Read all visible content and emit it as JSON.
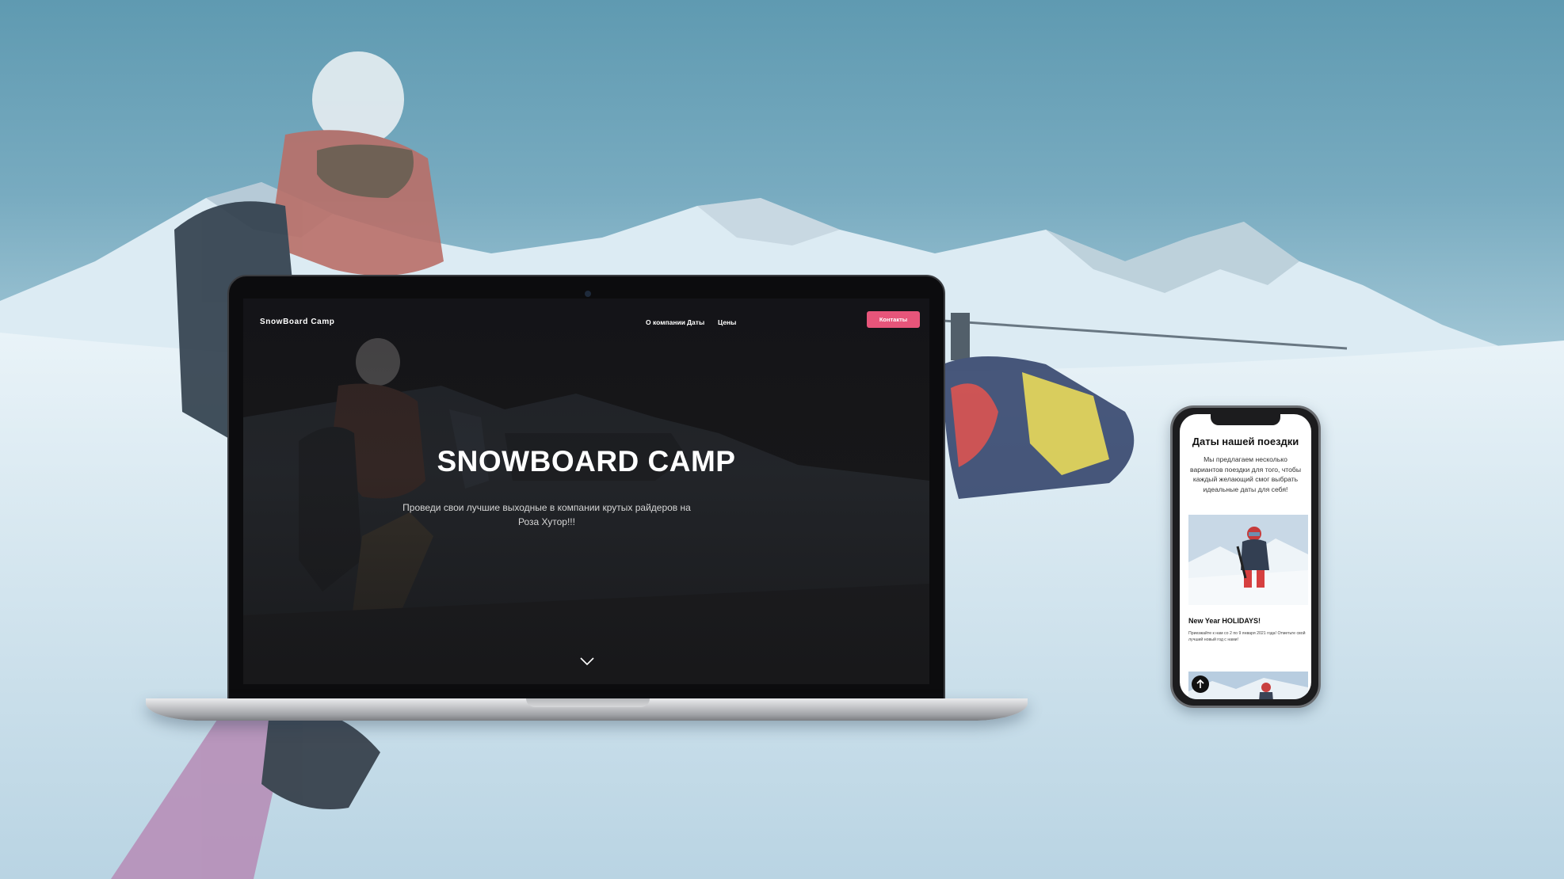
{
  "colors": {
    "accent": "#e7557a",
    "laptop_bg": "#141416",
    "text_light": "#ffffff"
  },
  "site": {
    "brand": "SnowBoard Camp",
    "nav": [
      {
        "label": "О компании"
      },
      {
        "label": "Даты"
      },
      {
        "label": "Цены"
      }
    ],
    "cta_label": "Контакты",
    "hero_title": "SNOWBOARD CAMP",
    "hero_subtitle": "Проведи свои лучшие выходные в компании крутых райдеров на Роза Хутор!!!",
    "scroll_icon": "chevron-down-icon"
  },
  "mobile": {
    "section_title": "Даты нашей поездки",
    "section_text": "Мы предлагаем несколько вариантов поездки для того, чтобы каждый желающий смог выбрать идеальные даты для себя!",
    "card_title": "New Year HOLIDAYS!",
    "card_text": "Приезжайте к нам со 2 по 9 января 2021 года! Отметьте свой лучший новый год с нами!",
    "up_icon": "arrow-up-icon"
  }
}
